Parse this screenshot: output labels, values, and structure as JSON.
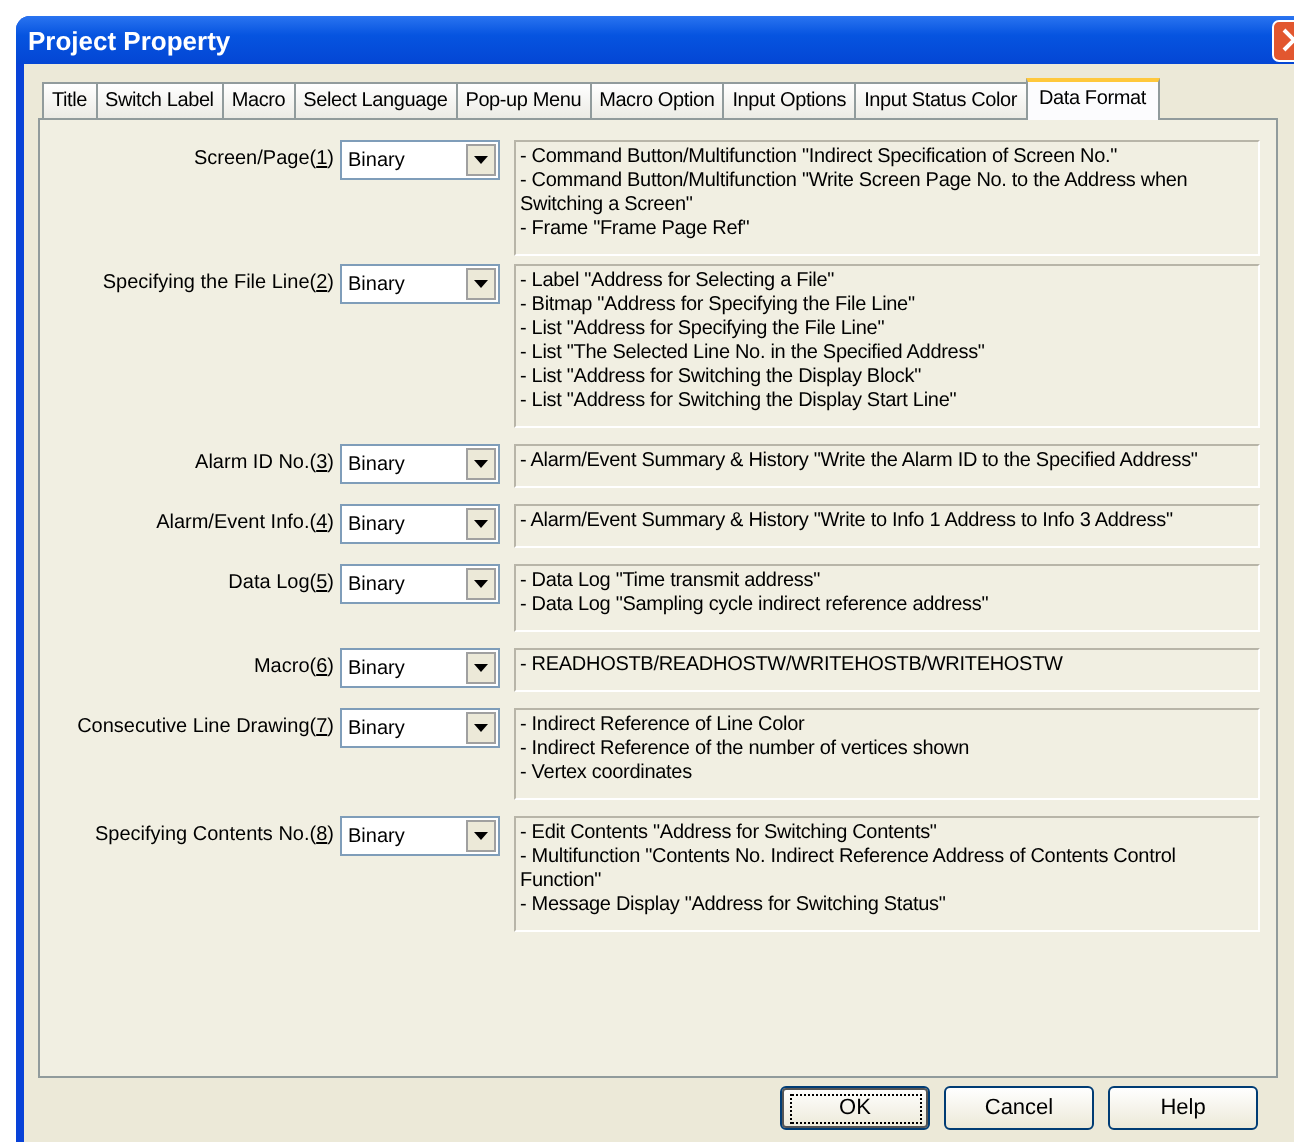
{
  "window": {
    "title": "Project Property"
  },
  "tabs": [
    {
      "label": "Title",
      "selected": false
    },
    {
      "label": "Switch Label",
      "selected": false
    },
    {
      "label": "Macro",
      "selected": false
    },
    {
      "label": "Select Language",
      "selected": false
    },
    {
      "label": "Pop-up Menu",
      "selected": false
    },
    {
      "label": "Macro Option",
      "selected": false
    },
    {
      "label": "Input Options",
      "selected": false
    },
    {
      "label": "Input Status Color",
      "selected": false
    },
    {
      "label": "Data Format",
      "selected": true
    }
  ],
  "rows": [
    {
      "label": "Screen/Page(",
      "mnemonic": "1",
      "label_end": ")",
      "value": "Binary",
      "description": [
        "- Command Button/Multifunction \"Indirect Specification of Screen No.\"",
        "- Command Button/Multifunction \"Write Screen Page No. to the Address when Switching a Screen\"",
        "- Frame \"Frame Page Ref\""
      ]
    },
    {
      "label": "Specifying the File Line(",
      "mnemonic": "2",
      "label_end": ")",
      "value": "Binary",
      "description": [
        "- Label \"Address for Selecting a File\"",
        "- Bitmap \"Address for Specifying the File Line\"",
        "- List \"Address for Specifying the File Line\"",
        "- List \"The Selected Line No. in the Specified Address\"",
        "- List \"Address for Switching the Display Block\"",
        "- List \"Address for Switching the Display Start Line\""
      ]
    },
    {
      "label": "Alarm ID No.(",
      "mnemonic": "3",
      "label_end": ")",
      "value": "Binary",
      "description": [
        "- Alarm/Event Summary & History \"Write the Alarm ID to the Specified Address\""
      ]
    },
    {
      "label": "Alarm/Event Info.(",
      "mnemonic": "4",
      "label_end": ")",
      "value": "Binary",
      "description": [
        "- Alarm/Event Summary & History \"Write to Info 1 Address to Info 3 Address\""
      ]
    },
    {
      "label": "Data Log(",
      "mnemonic": "5",
      "label_end": ")",
      "value": "Binary",
      "description": [
        "- Data Log \"Time transmit address\"",
        "- Data Log \"Sampling cycle indirect reference address\""
      ]
    },
    {
      "label": "Macro(",
      "mnemonic": "6",
      "label_end": ")",
      "value": "Binary",
      "description": [
        "- READHOSTB/READHOSTW/WRITEHOSTB/WRITEHOSTW"
      ]
    },
    {
      "label": "Consecutive Line Drawing(",
      "mnemonic": "7",
      "label_end": ")",
      "value": "Binary",
      "description": [
        "- Indirect Reference of Line Color",
        "- Indirect Reference of the number of vertices shown",
        "- Vertex coordinates"
      ]
    },
    {
      "label": "Specifying Contents No.(",
      "mnemonic": "8",
      "label_end": ")",
      "value": "Binary",
      "description": [
        "- Edit Contents \"Address for Switching Contents\"",
        "- Multifunction \"Contents No. Indirect Reference Address of Contents Control Function\"",
        "- Message Display \"Address for Switching Status\""
      ]
    }
  ],
  "buttons": [
    {
      "label": "OK",
      "default": true
    },
    {
      "label": "Cancel",
      "default": false
    },
    {
      "label": "Help",
      "default": false
    }
  ]
}
